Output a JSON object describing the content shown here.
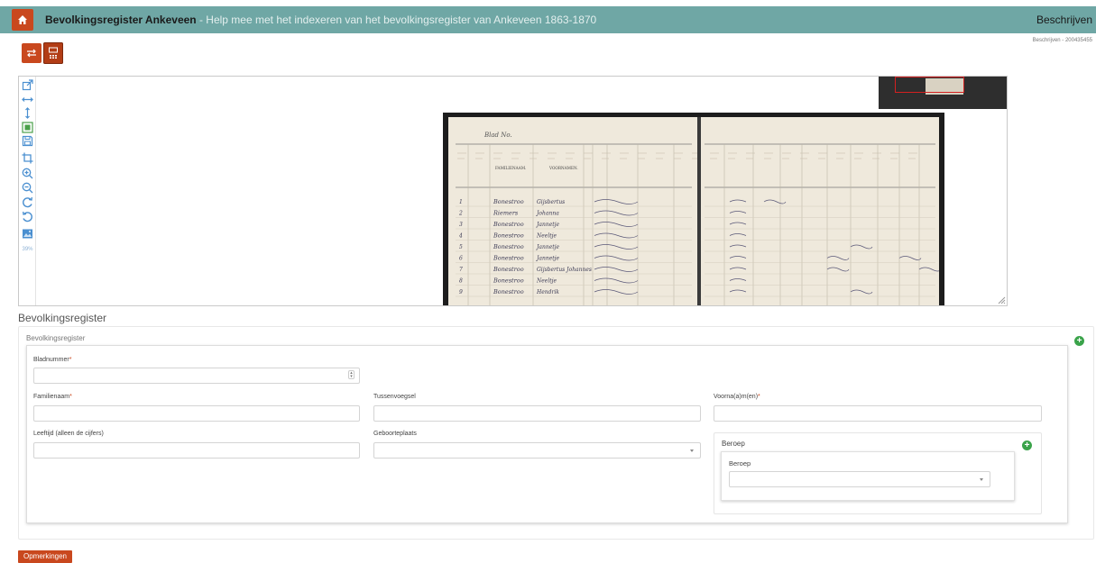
{
  "header": {
    "title": "Bevolkingsregister Ankeveen",
    "subtitle": " - Help mee met het indexeren van het bevolkingsregister van Ankeveen 1863-1870",
    "nav_right": "Beschrijven",
    "task_id": "Beschrijven - 200435455"
  },
  "viewer": {
    "zoom": "39%",
    "tools": [
      "external-link-icon",
      "fit-width-icon",
      "fit-height-icon",
      "fit-page-icon",
      "save-icon",
      "crop-icon",
      "zoom-in-icon",
      "zoom-out-icon",
      "rotate-right-icon",
      "rotate-left-icon",
      "image-icon"
    ],
    "scan": {
      "page_heading": "Blad No.",
      "left_columns": [
        "FAMILIENAAM.",
        "VOORNAMEN."
      ],
      "rows": [
        {
          "no": "1",
          "familienaam": "Bonestroo",
          "voornamen": "Gijsbertus"
        },
        {
          "no": "2",
          "familienaam": "Riemers",
          "voornamen": "Johanna"
        },
        {
          "no": "3",
          "familienaam": "Bonestroo",
          "voornamen": "Jannetje"
        },
        {
          "no": "4",
          "familienaam": "Bonestroo",
          "voornamen": "Neeltje"
        },
        {
          "no": "5",
          "familienaam": "Bonestroo",
          "voornamen": "Jannetje"
        },
        {
          "no": "6",
          "familienaam": "Bonestroo",
          "voornamen": "Jannetje"
        },
        {
          "no": "7",
          "familienaam": "Bonestroo",
          "voornamen": "Gijsbertus Johannes"
        },
        {
          "no": "8",
          "familienaam": "Bonestroo",
          "voornamen": "Neeltje"
        },
        {
          "no": "9",
          "familienaam": "Bonestroo",
          "voornamen": "Hendrik"
        }
      ]
    }
  },
  "form": {
    "section_title": "Bevolkingsregister",
    "panel_label": "Bevolkingsregister",
    "fields": {
      "bladnummer": {
        "label": "Bladnummer",
        "value": ""
      },
      "familienaam": {
        "label": "Familienaam",
        "value": ""
      },
      "tussenvoegsel": {
        "label": "Tussenvoegsel",
        "value": ""
      },
      "voornamen": {
        "label": "Voorna(a)m(en)",
        "value": ""
      },
      "leeftijd": {
        "label": "Leeftijd (alleen de cijfers)",
        "value": ""
      },
      "geboorteplaats": {
        "label": "Geboorteplaats",
        "value": ""
      }
    },
    "beroep": {
      "panel_title": "Beroep",
      "label": "Beroep",
      "value": ""
    },
    "remarks_button": "Opmerkingen",
    "required_marker": "*",
    "plus_symbol": "+"
  },
  "colors": {
    "topbar": "#6fa7a5",
    "accent": "#c9481e",
    "add": "#3aa34a",
    "tool": "#4a8fd0"
  }
}
